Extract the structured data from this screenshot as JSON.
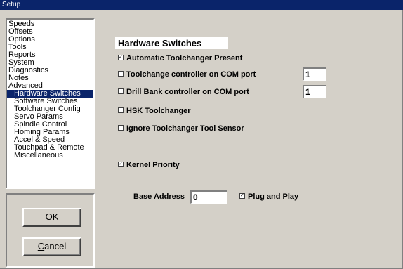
{
  "window": {
    "title": "Setup"
  },
  "nav": {
    "items": [
      {
        "label": "Speeds"
      },
      {
        "label": "Offsets"
      },
      {
        "label": "Options"
      },
      {
        "label": "Tools"
      },
      {
        "label": "Reports"
      },
      {
        "label": "System"
      },
      {
        "label": "Diagnostics"
      },
      {
        "label": "Notes"
      },
      {
        "label": "Advanced"
      },
      {
        "label": "Hardware Switches"
      },
      {
        "label": "Software Switches"
      },
      {
        "label": "Toolchanger Config"
      },
      {
        "label": "Servo Params"
      },
      {
        "label": "Spindle Control"
      },
      {
        "label": "Homing Params"
      },
      {
        "label": "Accel & Speed"
      },
      {
        "label": "Touchpad & Remote"
      },
      {
        "label": "Miscellaneous"
      }
    ],
    "selected": "Hardware Switches"
  },
  "buttons": {
    "ok": {
      "mnemonic": "O",
      "rest": "K"
    },
    "cancel": {
      "mnemonic": "C",
      "rest": "ancel"
    }
  },
  "panel": {
    "title": "Hardware Switches",
    "options": {
      "auto_toolchanger": {
        "label": "Automatic Toolchanger Present",
        "checked": true
      },
      "toolchange_com": {
        "label": "Toolchange controller on COM port",
        "checked": false,
        "port": "1"
      },
      "drillbank_com": {
        "label": "Drill Bank controller on COM port",
        "checked": false,
        "port": "1"
      },
      "hsk": {
        "label": "HSK Toolchanger",
        "checked": false
      },
      "ignore_sensor": {
        "label": "Ignore Toolchanger Tool Sensor",
        "checked": false
      },
      "kernel_priority": {
        "label": "Kernel Priority",
        "checked": true
      },
      "plug_and_play": {
        "label": "Plug and Play",
        "checked": true
      }
    },
    "base_address": {
      "label": "Base Address",
      "value": "0"
    }
  },
  "checkmark": "✓"
}
